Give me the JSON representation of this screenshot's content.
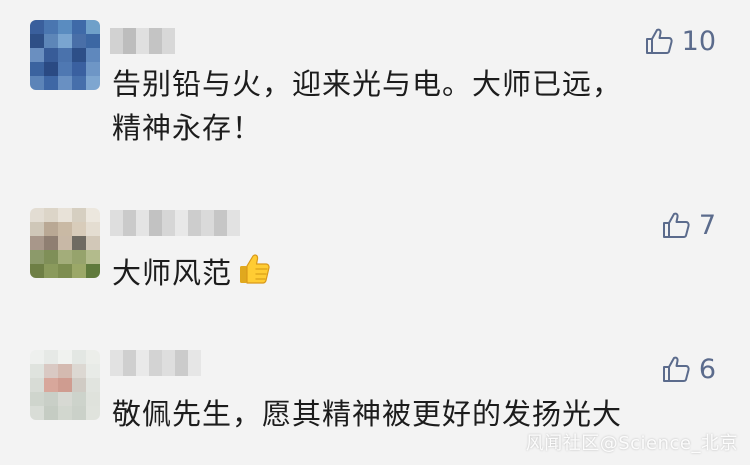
{
  "comments": [
    {
      "like_count": "10",
      "text_line1": "告别铅与火，迎来光与电。大师已远，",
      "text_line2": "精神永存！"
    },
    {
      "like_count": "7",
      "text": "大师风范"
    },
    {
      "like_count": "6",
      "text": "敬佩先生，愿其精神被更好的发扬光大"
    }
  ],
  "watermark": "风闻社区@Science_北京",
  "colors": {
    "background": "#f3f3f3",
    "like_accent": "#5b6b8c",
    "text": "#1c1c1c"
  }
}
